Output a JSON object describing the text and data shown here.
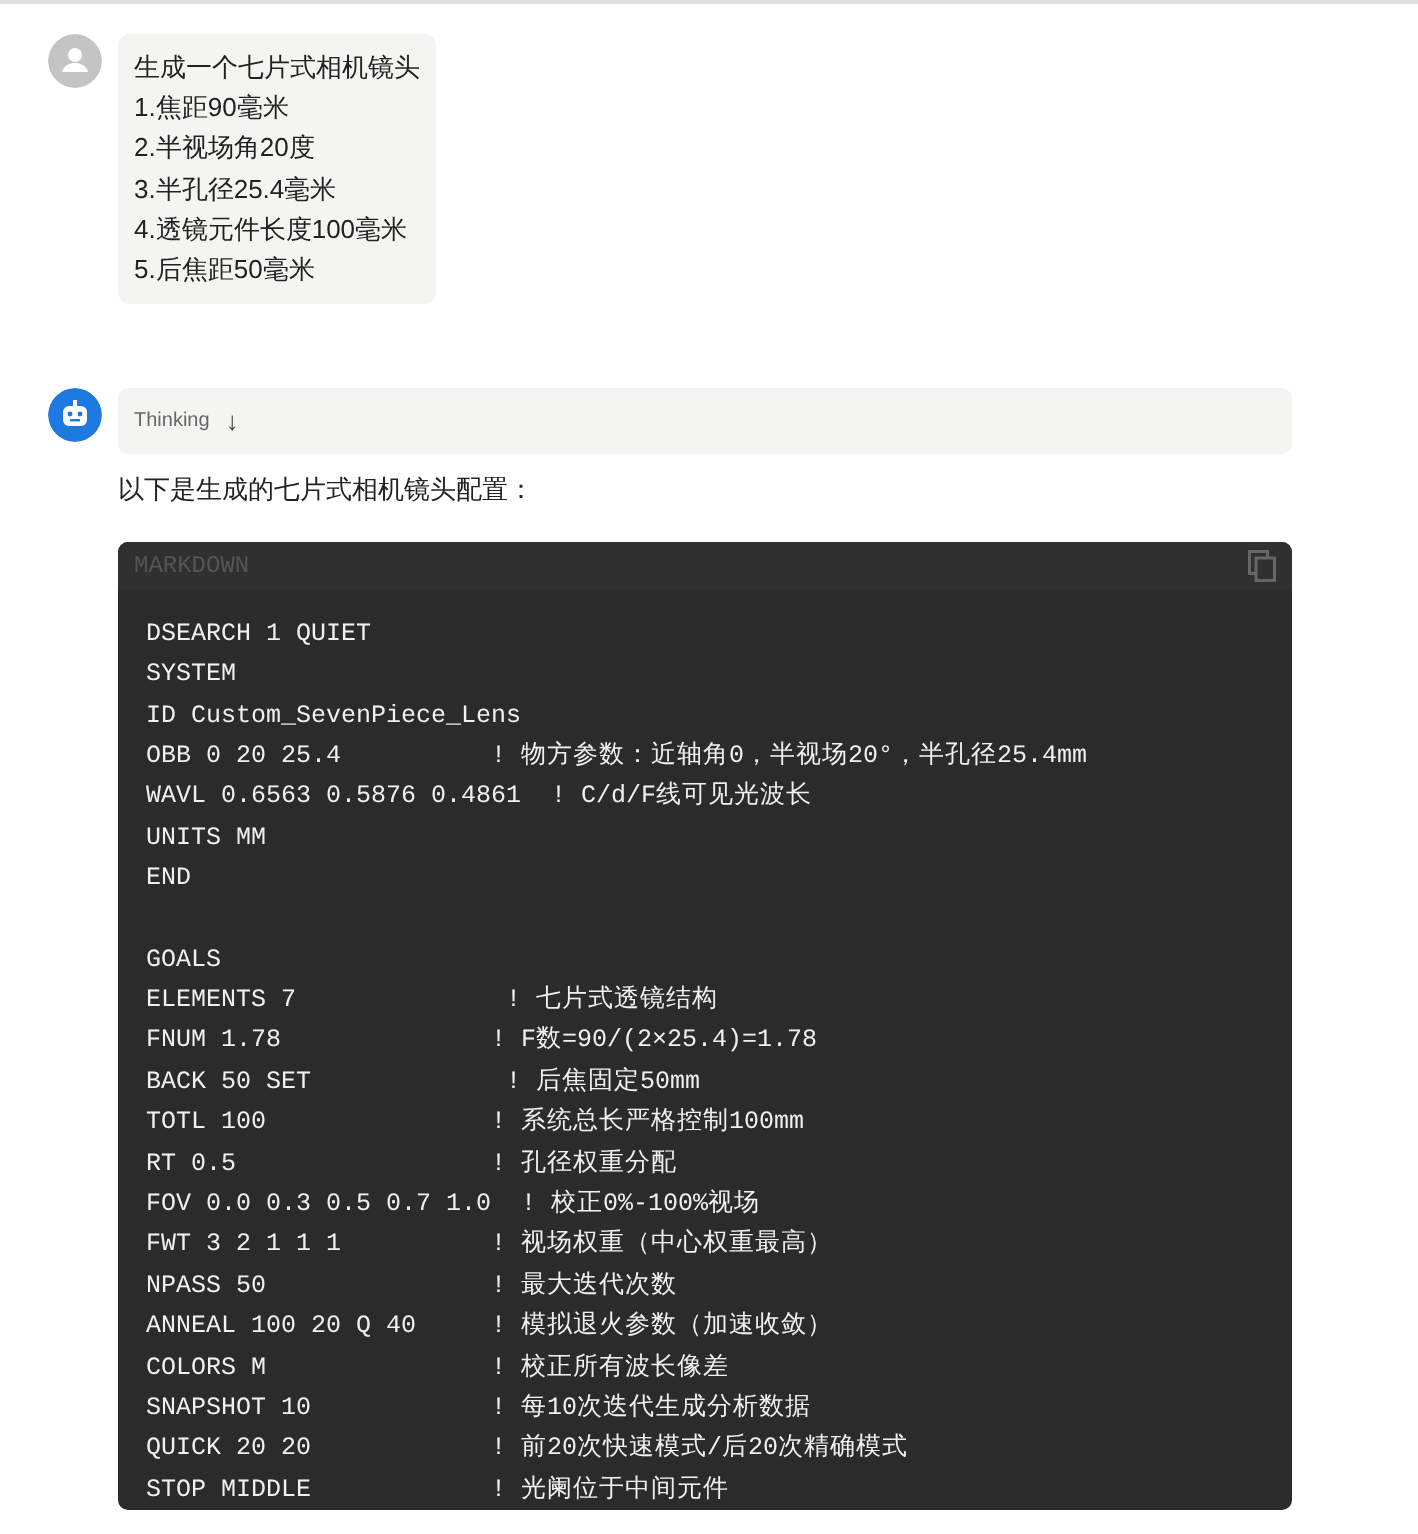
{
  "user_message": {
    "lines": [
      "生成一个七片式相机镜头",
      "1.焦距90毫米",
      "2.半视场角20度",
      "3.半孔径25.4毫米",
      "4.透镜元件长度100毫米",
      "5.后焦距50毫米"
    ]
  },
  "assistant_message": {
    "thinking": {
      "label": "Thinking",
      "arrow": "↓",
      "expanded": false
    },
    "intro": "以下是生成的七片式相机镜头配置：",
    "code_block": {
      "language": "MARKDOWN",
      "sections": [
        [
          "DSEARCH 1 QUIET",
          "SYSTEM",
          "ID Custom_SevenPiece_Lens",
          "OBB 0 20 25.4          ! 物方参数：近轴角0，半视场20°，半孔径25.4mm",
          "WAVL 0.6563 0.5876 0.4861  ! C/d/F线可见光波长",
          "UNITS MM",
          "END"
        ],
        [
          "GOALS",
          "ELEMENTS 7              ! 七片式透镜结构",
          "FNUM 1.78              ! F数=90/(2×25.4)=1.78",
          "BACK 50 SET             ! 后焦固定50mm",
          "TOTL 100               ! 系统总长严格控制100mm",
          "RT 0.5                 ! 孔径权重分配",
          "FOV 0.0 0.3 0.5 0.7 1.0  ! 校正0%-100%视场",
          "FWT 3 2 1 1 1          ! 视场权重（中心权重最高）",
          "NPASS 50               ! 最大迭代次数",
          "ANNEAL 100 20 Q 40     ! 模拟退火参数（加速收敛）",
          "COLORS M               ! 校正所有波长像差",
          "SNAPSHOT 10            ! 每10次迭代生成分析数据",
          "QUICK 20 20            ! 前20次快速模式/后20次精确模式",
          "STOP MIDDLE            ! 光阑位于中间元件"
        ]
      ]
    }
  }
}
